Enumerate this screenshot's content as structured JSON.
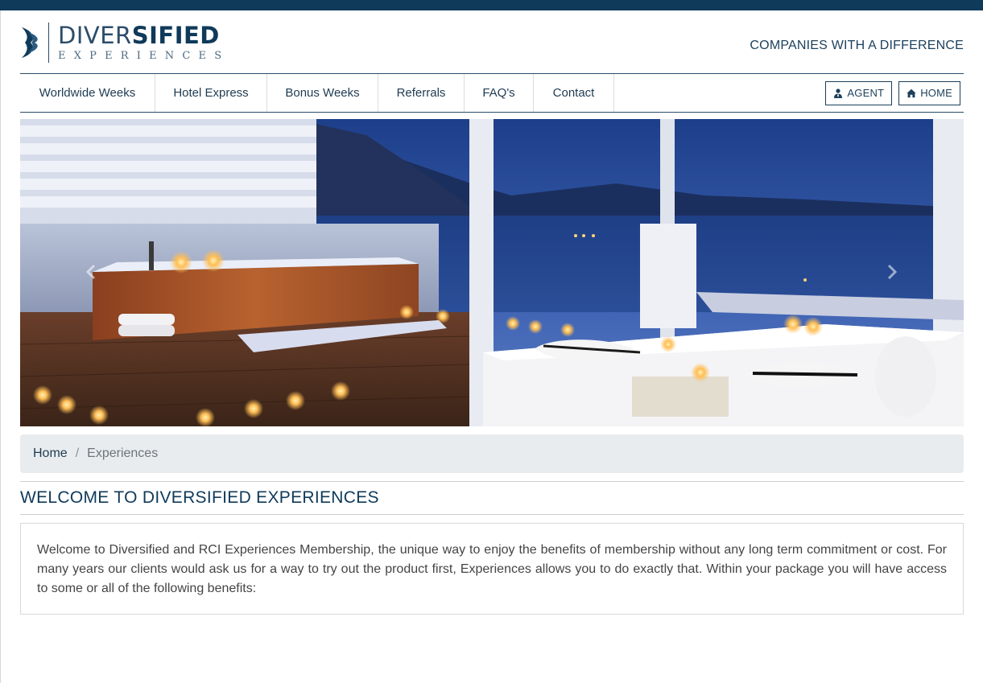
{
  "brand": {
    "name_light": "DIVER",
    "name_bold": "SIFIED",
    "sub": "EXPERIENCES",
    "tagline": "COMPANIES WITH A DIFFERENCE",
    "primary_color": "#0f3a5a"
  },
  "nav": {
    "items": [
      {
        "label": "Worldwide Weeks"
      },
      {
        "label": "Hotel Express"
      },
      {
        "label": "Bonus Weeks"
      },
      {
        "label": "Referrals"
      },
      {
        "label": "FAQ's"
      },
      {
        "label": "Contact"
      }
    ],
    "agent_label": "AGENT",
    "home_label": "HOME",
    "agent_icon": "user-tie-icon",
    "home_icon": "home-icon"
  },
  "carousel": {
    "prev_icon": "chevron-left-icon",
    "next_icon": "chevron-right-icon"
  },
  "breadcrumb": {
    "home": "Home",
    "separator": "/",
    "current": "Experiences"
  },
  "page": {
    "heading": "WELCOME TO DIVERSIFIED EXPERIENCES",
    "intro": "Welcome to Diversified and RCI Experiences Membership, the unique way to enjoy the benefits of membership without any long term commitment or cost. For many years our clients would ask us for a way to try out the product first, Experiences allows you to do exactly that. Within your package you will have access to some or all of the following benefits:"
  }
}
